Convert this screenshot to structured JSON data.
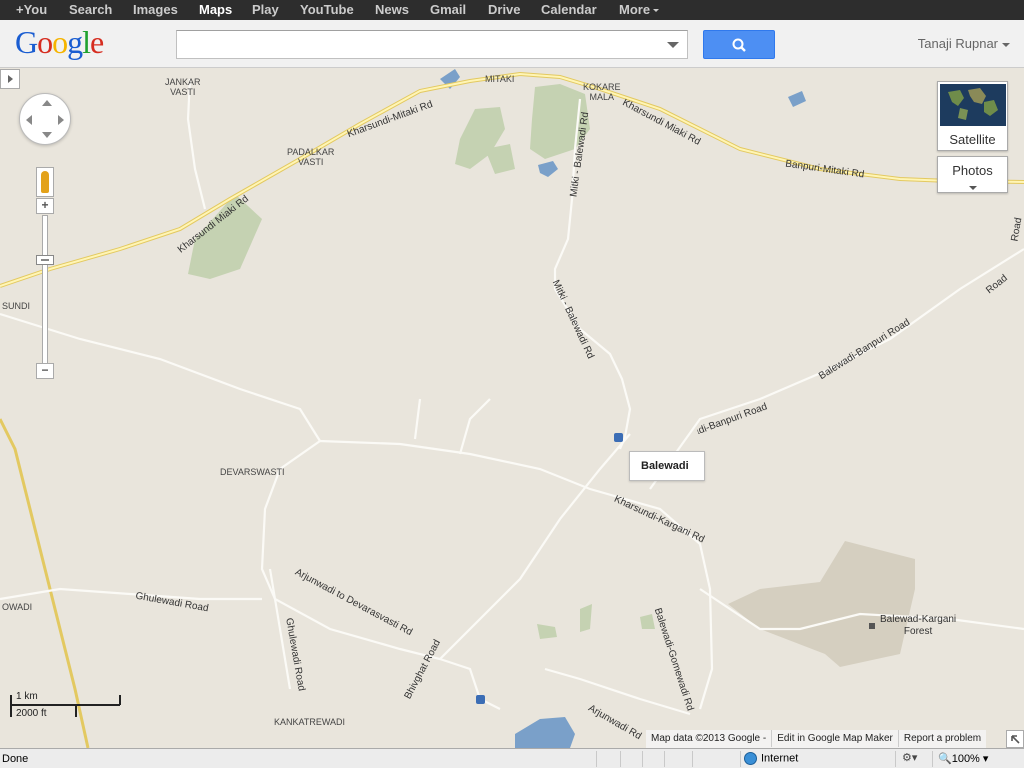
{
  "gbar": {
    "items": [
      {
        "label": "+You",
        "active": false
      },
      {
        "label": "Search",
        "active": false
      },
      {
        "label": "Images",
        "active": false
      },
      {
        "label": "Maps",
        "active": true
      },
      {
        "label": "Play",
        "active": false
      },
      {
        "label": "YouTube",
        "active": false
      },
      {
        "label": "News",
        "active": false
      },
      {
        "label": "Gmail",
        "active": false
      },
      {
        "label": "Drive",
        "active": false
      },
      {
        "label": "Calendar",
        "active": false
      },
      {
        "label": "More",
        "active": false
      }
    ]
  },
  "header": {
    "logo_letters": [
      "G",
      "o",
      "o",
      "g",
      "l",
      "e"
    ],
    "logo_colors": [
      "#1a5dd1",
      "#d62d20",
      "#f5b400",
      "#1a5dd1",
      "#1fa12e",
      "#d62d20"
    ],
    "search_value": "",
    "search_button_icon": "search-icon",
    "user_name": "Tanaji Rupnar"
  },
  "map": {
    "place_labels": {
      "jankar": "JANKAR\nVASTI",
      "mitaki": "MITAKI",
      "kokare": "KOKARE\nMALA",
      "padalkar": "PADALKAR\nVASTI",
      "sundi": "SUNDI",
      "devarswasti": "DEVARSWASTI",
      "owadi": "OWADI",
      "kankatrewadi": "KANKATREWADI"
    },
    "road_labels": {
      "kharsundi_mitaki": "Kharsundi-Mitaki Rd",
      "kharsundi_miaki": "Kharsundi Miaki Rd",
      "kharsundi_miaki_2": "Kharsundi Miaki Rd",
      "banpuri_mitaki": "Banpuri-Mitaki Rd",
      "mitki_balewadi_1": "Mitki - Balewadi Rd",
      "mitki_balewadi_2": "Mitki - Balewadi Rd",
      "balewadi_banpuri_1": "Balewadi-Banpuri Road",
      "balewadi_banpuri_2": "Balewadi-Banpuri Road",
      "road_right_1": "Road",
      "road_right_2": "Road",
      "kharsundi_kargani": "Kharsundi-Kargani Rd",
      "ghulewadi": "Ghulewadi Road",
      "arjunwadi_devarasvasti": "Arjunwadi to Devarasvasti Rd",
      "ghulewadi_vertical": "Ghulewadi Road",
      "bhivghat": "Bhivghat Road",
      "arjunwadi_rd": "Arjunwadi Rd",
      "balewadi_gomewadi": "Balewadi-Gomewadi Rd",
      "forest": "Balewad-Kargani\nForest"
    },
    "info_box": "Balewadi",
    "satellite_label": "Satellite",
    "photos_label": "Photos",
    "zoom_in": "+",
    "zoom_out": "−",
    "scale_km": "1 km",
    "scale_ft": "2000 ft",
    "footer": {
      "map_data": "Map data ©2013 Google -",
      "edit": "Edit in Google Map Maker",
      "report": "Report a problem"
    }
  },
  "statusbar": {
    "left": "Done",
    "zone": "Internet",
    "zoom": "100%"
  }
}
